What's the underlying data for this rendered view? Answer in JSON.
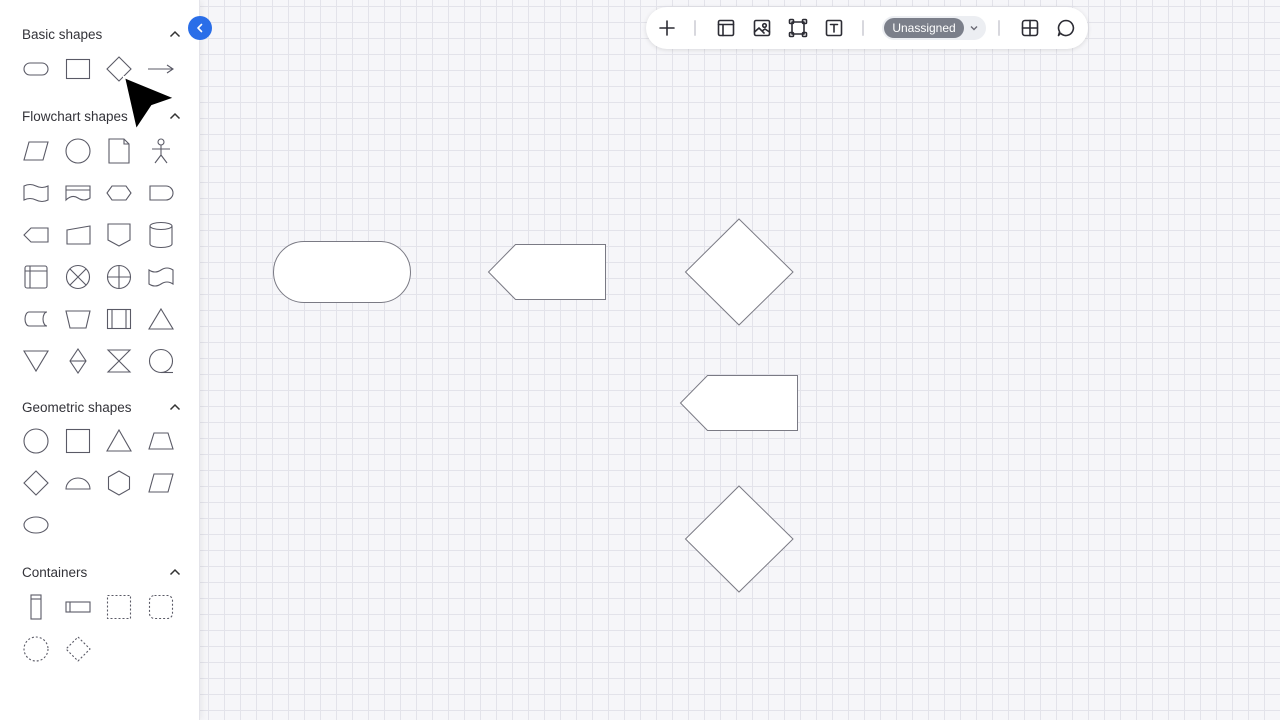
{
  "sidebar": {
    "sections": [
      {
        "title": "Basic shapes",
        "shapes": [
          "terminator",
          "rectangle",
          "diamond",
          "arrow-line"
        ]
      },
      {
        "title": "Flowchart shapes",
        "shapes": [
          "data-parallelogram",
          "connector-circle",
          "document",
          "actor",
          "tape",
          "multiple-documents",
          "preparation-hexagon",
          "delay",
          "display",
          "manual-input",
          "off-page-connector",
          "database-cylinder",
          "internal-storage",
          "summing-junction",
          "or-junction",
          "punched-tape",
          "stored-data",
          "manual-operation",
          "predefined-process",
          "extract-triangle",
          "merge-triangle",
          "sort",
          "collate",
          "sequential-data"
        ]
      },
      {
        "title": "Geometric shapes",
        "shapes": [
          "circle",
          "square",
          "triangle",
          "trapezoid",
          "diamond",
          "semicircle",
          "hexagon",
          "parallelogram",
          "ellipse"
        ]
      },
      {
        "title": "Containers",
        "shapes": [
          "vertical-swimlane",
          "horizontal-swimlane",
          "dashed-rectangle-container",
          "dashed-rounded-container",
          "dashed-circle-container",
          "dashed-diamond-container"
        ]
      }
    ]
  },
  "toolbar": {
    "assign_label": "Unassigned",
    "icons": [
      "plus-icon",
      "template-icon",
      "image-icon",
      "frame-icon",
      "text-icon",
      "grid-icon",
      "comment-icon"
    ]
  },
  "canvas": {
    "shapes": [
      "terminator",
      "display",
      "diamond",
      "display",
      "diamond"
    ]
  },
  "colors": {
    "accent": "#2a6ee8",
    "pill": "#7b7f8a",
    "grid": "#e3e3ea",
    "shape_stroke": "#7a7a84"
  }
}
